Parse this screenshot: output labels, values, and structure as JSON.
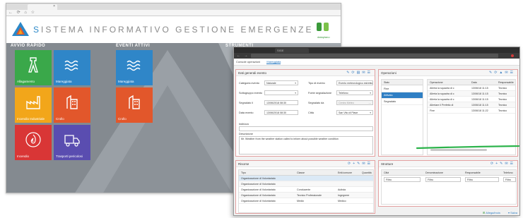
{
  "back_window": {
    "tab_label": "",
    "tab_close": "×",
    "nav_buttons": "← ⟳ ⌂ ☆",
    "system_title_prefix": "S",
    "system_title": "ISTEMA INFORMATIVO GESTIONE EMERGENZE",
    "partner_logo_text": "dataplano",
    "sections": {
      "quick": "AVVIO RAPIDO",
      "events": "EVENTI ATTIVI",
      "tools": "STRUMENTI"
    },
    "quick_tiles": [
      {
        "label": "Allagamento",
        "icon": "tower-icon",
        "color": "#3aa84a"
      },
      {
        "label": "Mareggiata",
        "icon": "waves-icon",
        "color": "#2f86c8"
      },
      {
        "label": "Incendio Industriale",
        "icon": "factory-icon",
        "color": "#f2a61a"
      },
      {
        "label": "Crollo",
        "icon": "building-icon",
        "color": "#e2572b"
      },
      {
        "label": "Incendio",
        "icon": "fire-icon",
        "color": "#d93636"
      },
      {
        "label": "Trasporti pericolosi",
        "icon": "truck-icon",
        "color": "#5a4db0"
      }
    ],
    "event_tiles": [
      {
        "label": "Mareggiata",
        "icon": "waves-icon",
        "color": "#2f86c8"
      },
      {
        "label": "Crollo",
        "icon": "building-icon",
        "color": "#e2572b"
      }
    ]
  },
  "front_window": {
    "tab_label": "SIGE",
    "breadcrumbs": [
      "Console operazioni",
      "Mareggiata"
    ],
    "general": {
      "title": "Dati generali evento",
      "fields": {
        "categoria_label": "Categoria evento",
        "categoria_value": "Naturale",
        "tipo_label": "Tipo di evento",
        "tipo_value": "Evento meteorologico estremo",
        "sottogruppo_label": "Sottogruppo evento",
        "sottogruppo_value": "",
        "fonte_label": "Fonte segnalazione",
        "fonte_value": "Telefono",
        "segnalato_label": "Segnalato il",
        "segnalato_value": "13/06/2018 08:30",
        "segnalato_da_label": "Segnalato da",
        "segnalato_da_value": "Centro Meteo",
        "data_label": "Data evento",
        "data_value": "13/06/2018 08:30",
        "citta_label": "Città",
        "citta_value": "San Vito di Piave",
        "indirizzo_label": "Indirizzo",
        "descrizione_label": "Descrizione",
        "descrizione_value": "Mr. Weather from the weather station called to inform about possible weather condition"
      }
    },
    "operations": {
      "title": "Operazioni",
      "list_header": "Stato",
      "list_items": [
        "Fine",
        "Attivato",
        "Segnalato"
      ],
      "selected_index": 1,
      "table_headers": [
        "Operazione",
        "Data",
        "Responsabile"
      ],
      "rows": [
        [
          "Allerta la squadra di c",
          "13/06/18 11:15",
          "Tecnico"
        ],
        [
          "Allerta la squadra di c",
          "13/06/18 11:15",
          "Tecnico"
        ],
        [
          "Allerta la squadra di c",
          "13/06/18 11:15",
          "Tecnico"
        ],
        [
          "Allertare il Prefetto di",
          "13/06/18 11:15",
          "Tecnico"
        ],
        [
          "Fine",
          "13/06/18 11:22",
          "Tecnico"
        ]
      ]
    },
    "persons": {
      "title": "Risorse",
      "headers": [
        "Tipo",
        "Classe",
        "Enti/comune",
        "Quantità"
      ],
      "rows": [
        [
          "Organizzazione di Volontariato",
          "",
          "",
          ""
        ],
        [
          "Organizzazione di Volontariato",
          "",
          "",
          ""
        ],
        [
          "Organizzazione di Volontariato",
          "Conducente",
          "Autista",
          ""
        ],
        [
          "Organizzazione di Volontariato",
          "Tecnico Professionale",
          "Ingegnere",
          ""
        ],
        [
          "Organizzazione di Volontariato",
          "Medici",
          "Medico",
          ""
        ]
      ]
    },
    "structures": {
      "title": "Strutture",
      "headers": [
        "Città",
        "Denominazione",
        "Responsabile",
        "Telefono"
      ],
      "filters": [
        "Filtro",
        "Filtro",
        "Filtro",
        "Filtro"
      ]
    },
    "footer": {
      "attach": "Allega/invia",
      "save": "Salva"
    }
  }
}
